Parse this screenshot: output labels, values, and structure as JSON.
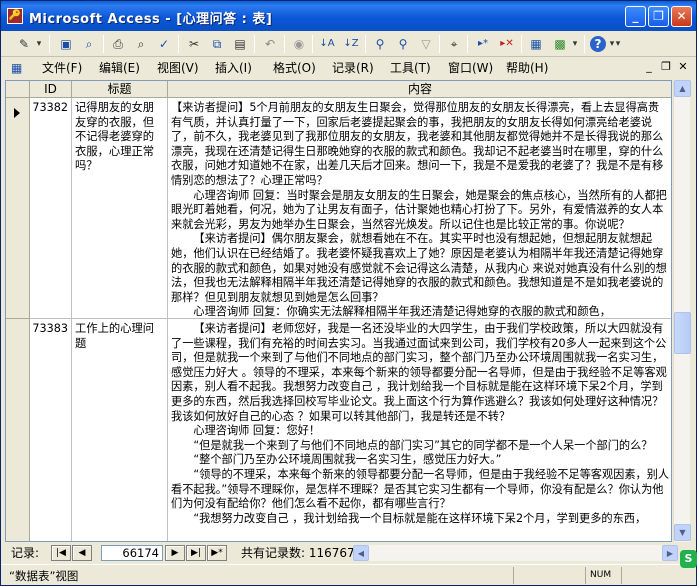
{
  "window": {
    "app_icon": "🔑",
    "title": "Microsoft Access - [心理问答 : 表]",
    "buttons": {
      "minimize": "_",
      "restore": "❐",
      "close": "✕"
    }
  },
  "toolbar": {
    "icons": [
      {
        "name": "design-view-icon",
        "glyph": "✎",
        "style": "blue"
      },
      {
        "name": "dropdown-arrow-icon",
        "glyph": "▾",
        "style": ""
      },
      {
        "name": "save-icon",
        "glyph": "▣",
        "style": "blue"
      },
      {
        "name": "file-search-icon",
        "glyph": "⌕",
        "style": "blue"
      },
      {
        "name": "print-icon",
        "glyph": "⎙",
        "style": ""
      },
      {
        "name": "print-preview-icon",
        "glyph": "⌕",
        "style": ""
      },
      {
        "name": "spelling-icon",
        "glyph": "✓",
        "style": "blue"
      },
      {
        "name": "cut-icon",
        "glyph": "✂",
        "style": ""
      },
      {
        "name": "copy-icon",
        "glyph": "⧉",
        "style": "blue"
      },
      {
        "name": "paste-icon",
        "glyph": "▤",
        "style": ""
      },
      {
        "name": "undo-icon",
        "glyph": "↶",
        "style": ""
      },
      {
        "name": "hyperlink-icon",
        "glyph": "◉",
        "style": ""
      },
      {
        "name": "sort-ascending-icon",
        "glyph": "↓A",
        "style": "blue"
      },
      {
        "name": "sort-descending-icon",
        "glyph": "↓Z",
        "style": "blue"
      },
      {
        "name": "filter-by-selection-icon",
        "glyph": "⚲",
        "style": "blue"
      },
      {
        "name": "filter-by-form-icon",
        "glyph": "⚲",
        "style": "blue"
      },
      {
        "name": "apply-filter-icon",
        "glyph": "▽",
        "style": ""
      },
      {
        "name": "find-icon",
        "glyph": "⌖",
        "style": ""
      },
      {
        "name": "new-record-icon",
        "glyph": "▸*",
        "style": "blue"
      },
      {
        "name": "delete-record-icon",
        "glyph": "▸✕",
        "style": "red"
      },
      {
        "name": "database-window-icon",
        "glyph": "▦",
        "style": "blue"
      },
      {
        "name": "new-object-icon",
        "glyph": "▩",
        "style": "green"
      },
      {
        "name": "help-icon",
        "glyph": "?",
        "style": "blue"
      },
      {
        "name": "toolbar-options-icon",
        "glyph": "▾",
        "style": ""
      }
    ]
  },
  "menubar": {
    "grid_icon": "▦",
    "items": [
      "文件(F)",
      "编辑(E)",
      "视图(V)",
      "插入(I)",
      "格式(O)",
      "记录(R)",
      "工具(T)",
      "窗口(W)",
      "帮助(H)"
    ],
    "mdi_buttons": {
      "minimize": "_",
      "restore": "❐",
      "close": "✕"
    }
  },
  "grid": {
    "columns": [
      "ID",
      "标题",
      "内容"
    ],
    "rows": [
      {
        "id": "73382",
        "title": "记得朋友的女朋友穿的衣服，但不记得老婆穿的衣服，心理正常吗？",
        "content": [
          "【来访者提问】5个月前朋友的女朋友生日聚会，觉得那位朋友的女朋友长得漂亮，看上去显得高贵有气质，并认真打量了一下，回家后老婆提起聚会的事，我把朋友的女朋友长得如何漂亮给老婆说了，前不久，我老婆见到了我那位朋友的女朋友，我老婆和其他朋友都觉得她并不是长得我说的那么漂亮，我现在还清楚记得生日那晚她穿的衣服的款式和颜色。我却记不起老婆当时在哪里，穿的什么衣服，问她才知道她不在家，出差几天后才回来。想问一下，我是不是爱我的老婆了？我是不是有移情别恋的想法了？心理正常吗？",
          "心理咨询师 回复：当时聚会是朋友女朋友的生日聚会，她是聚会的焦点核心，当然所有的人都把眼光盯着她看，何况，她为了让男友有面子，估计聚她也精心打扮了下。另外，有爱情滋养的女人本来就会光彩，男友为她举办生日聚会，当然容光焕发。所以记住也是比较正常的事。你说呢？",
          "【来访者提问】偶尔朋友聚会，就想看她在不在。其实平时也没有想起她，但想起朋友就想起她，他们认识在已经结婚了。我老婆怀疑我喜欢上了她？原因是老婆认为相隔半年我还清楚记得她穿的衣服的款式和颜色，如果对她没有感觉就不会记得这么清楚，从我内心 来说对她真没有什么别的想法，但我也无法解释相隔半年我还清楚记得她穿的衣服的款式和颜色。我想知道是不是如我老婆说的那样？但见到朋友就想见到她是怎么回事？",
          "心理咨询师 回复：你确实无法解释相隔半年我还清楚记得她穿的衣服的款式和颜色，"
        ]
      },
      {
        "id": "73383",
        "title": "工作上的心理问题",
        "content": [
          "【来访者提问】老师您好，我是一名还没毕业的大四学生，由于我们学校政策，所以大四就没有了一些课程，我们有充裕的时间去实习。当我通过面试来到公司，我们学校有20多人一起来到这个公司，但是就我一个来到了与他们不同地点的部门实习，整个部门乃至办公环境周围就我一名实习生，感觉压力好大 。领导的不理采，本来每个新来的领导都要分配一名导师，但是由于我经验不足等客观因素，别人看不起我。我想努力改变自己 ，我计划给我一个目标就是能在这样环境下呆2个月，学到更多的东西，然后我选择回校写毕业论文。我上面这个行为算作逃避么？我该如何处理好这种情况？我该如何放好自己的心态 ？如果可以转其他部门，我是转还是不转？",
          "心理咨询师 回复：您好！",
          "“但是就我一个来到了与他们不同地点的部门实习”其它的同学都不是一个人呆一个部门的么？",
          "“整个部门乃至办公环境周围就我一名实习生，感觉压力好大。”",
          "“领导的不理采，本来每个新来的领导都要分配一名导师，但是由于我经验不足等客观因素，别人看不起我。”领导不理睬你，是怎样不理睬？是否其它实习生都有一个导师，你没有配是么？你认为他们为何没有配给你？他们怎么看不起你，都有哪些言行？",
          "“我想努力改变自己 ，我计划给我一个目标就是能在这样环境下呆2个月，学到更多的东西，"
        ]
      }
    ]
  },
  "navbar": {
    "label": "记录:",
    "buttons": {
      "first": "|◀",
      "prev": "◀",
      "next": "▶",
      "last": "▶|",
      "new": "▶*"
    },
    "current_record": "66174",
    "total": "共有记录数: 116767"
  },
  "statusbar": {
    "text": "“数据表”视图",
    "num": "NUM"
  },
  "tray": {
    "glyph": "S"
  }
}
